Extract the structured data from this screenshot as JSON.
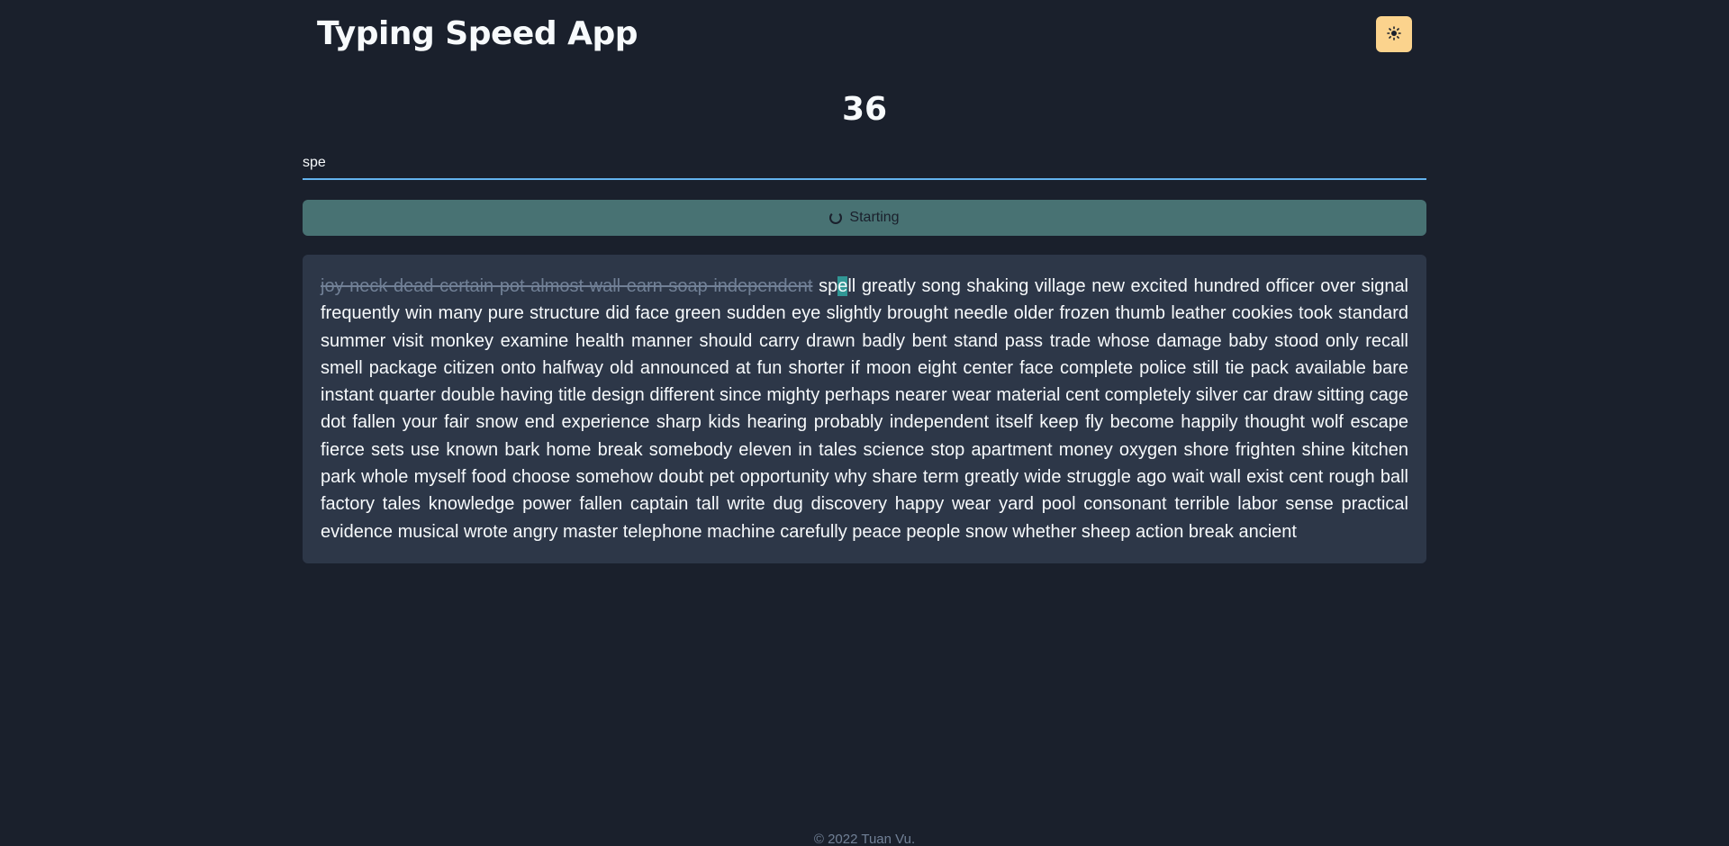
{
  "header": {
    "title": "Typing Speed App",
    "theme_icon": "sun-icon"
  },
  "timer": {
    "value": "36"
  },
  "input": {
    "value": "spe"
  },
  "start_button": {
    "label": "Starting",
    "icon": "spinner-icon"
  },
  "text": {
    "typed": "joy neck dead certain pot almost wall earn soap independent",
    "current_word": {
      "before": "sp",
      "cursor": "e",
      "after": "ll"
    },
    "remaining": "greatly song shaking village new excited hundred officer over signal frequently win many pure structure did face green sudden eye slightly brought needle older frozen thumb leather cookies took standard summer visit monkey examine health manner should carry drawn badly bent stand pass trade whose damage baby stood only recall smell package citizen onto halfway old announced at fun shorter if moon eight center face complete police still tie pack available bare instant quarter double having title design different since mighty perhaps nearer wear material cent completely silver car draw sitting cage dot fallen your fair snow end experience sharp kids hearing probably independent itself keep fly become happily thought wolf escape fierce sets use known bark home break somebody eleven in tales science stop apartment money oxygen shore frighten shine kitchen park whole myself food choose somehow doubt pet opportunity why share term greatly wide struggle ago wait wall exist cent rough ball factory tales knowledge power fallen captain tall write dug discovery happy wear yard pool consonant terrible labor sense practical evidence musical wrote angry master telephone machine carefully peace people snow whether sheep action break ancient"
  },
  "footer": {
    "text": "© 2022 Tuan Vu."
  }
}
